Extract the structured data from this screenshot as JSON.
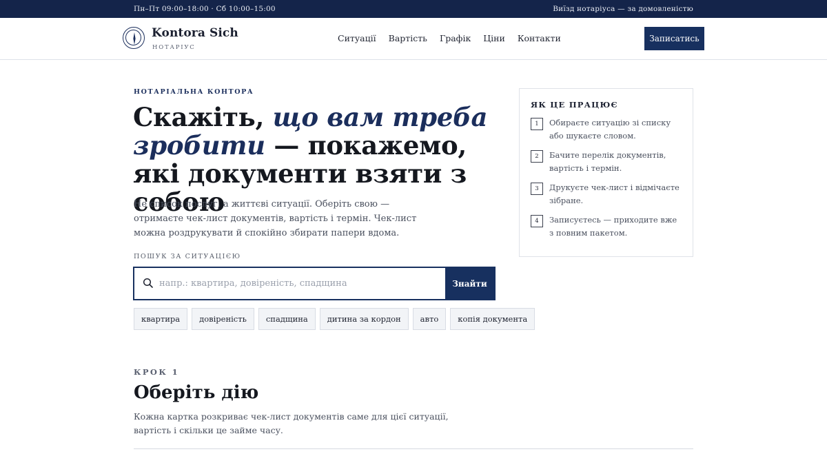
{
  "topbar": {
    "hours": "Пн–Пт 09:00–18:00 · Сб 10:00–15:00",
    "visit": "Виїзд нотаріуса — за домовленістю"
  },
  "header": {
    "brand_name": "Kontora Sich",
    "brand_sub": "НОТАРІУС",
    "nav": [
      "Ситуації",
      "Вартість",
      "Графік",
      "Ціни",
      "Контакти"
    ],
    "cta": "Записатись"
  },
  "hero": {
    "eyebrow": "НОТАРІАЛЬНА КОНТОРА",
    "title_part1": "Скажіть, ",
    "title_accent": "що вам треба зробити",
    "title_part2": " — покажемо, які документи взяти з собою",
    "description": "Не список послуг, а життєві ситуації. Оберіть свою — отримаєте чек-лист документів, вартість і термін. Чек-лист можна роздрукувати й спокійно збирати папери вдома."
  },
  "search": {
    "label": "ПОШУК ЗА СИТУАЦІЄЮ",
    "placeholder": "напр.: квартира, довіреність, спадщина",
    "value": "",
    "button": "Знайти",
    "chips": [
      "квартира",
      "довіреність",
      "спадщина",
      "дитина за кордон",
      "авто",
      "копія документа"
    ]
  },
  "how_it_works": {
    "title": "ЯК ЦЕ ПРАЦЮЄ",
    "steps": [
      {
        "num": "1",
        "text": "Обираєте ситуацію зі списку або шукаєте словом."
      },
      {
        "num": "2",
        "text": "Бачите перелік документів, вартість і термін."
      },
      {
        "num": "3",
        "text": "Друкуєте чек-лист і відмічаєте зібране."
      },
      {
        "num": "4",
        "text": "Записуєтесь — приходите вже з повним пакетом."
      }
    ]
  },
  "step_section": {
    "label": "КРОК 1",
    "title": "Оберіть дію",
    "description": "Кожна картка розкриває чек-лист документів саме для цієї ситуації, вартість і скільки це займе часу."
  },
  "colors": {
    "navy": "#14244a",
    "accent": "#1b2e5c",
    "button": "#17305f"
  }
}
